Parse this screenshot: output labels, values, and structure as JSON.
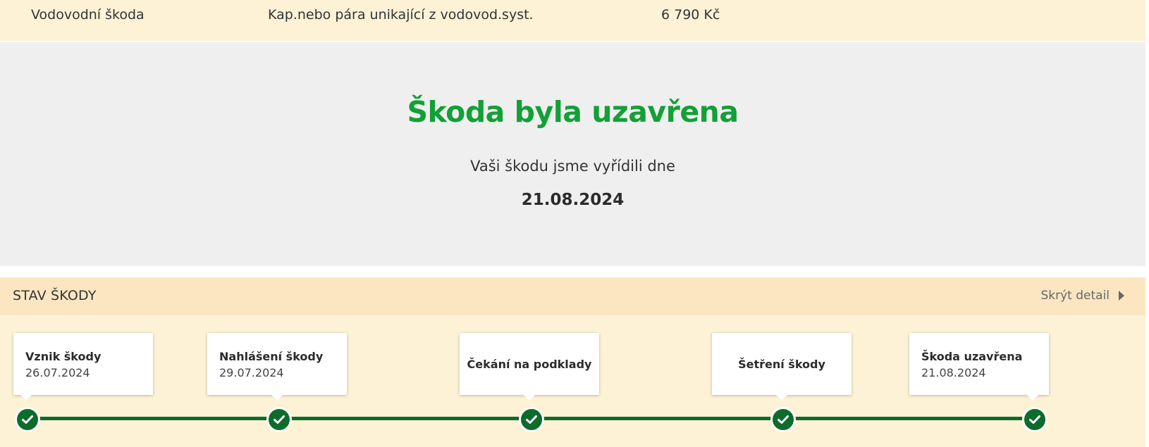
{
  "claim_row": {
    "type": "Vodovodní škoda",
    "cause": "Kap.nebo pára unikající z vodovod.syst.",
    "amount": "6 790 Kč"
  },
  "closed": {
    "title": "Škoda byla uzavřena",
    "text": "Vaši škodu jsme vyřídili dne",
    "date": "21.08.2024"
  },
  "status": {
    "title": "STAV ŠKODY",
    "toggle_label": "Skrýt detail",
    "steps": [
      {
        "name": "Vznik škody",
        "date": "26.07.2024",
        "completed": true
      },
      {
        "name": "Nahlášení škody",
        "date": "29.07.2024",
        "completed": true
      },
      {
        "name": "Čekání na podklady",
        "date": "",
        "completed": true
      },
      {
        "name": "Šetření škody",
        "date": "",
        "completed": true
      },
      {
        "name": "Škoda uzavřena",
        "date": "21.08.2024",
        "completed": true
      }
    ]
  },
  "colors": {
    "accent_green": "#12a037",
    "timeline_green": "#0d6b2b",
    "panel_bg": "#fdf2d5",
    "header_bg": "#fce6c2",
    "banner_bg": "#efefef"
  }
}
